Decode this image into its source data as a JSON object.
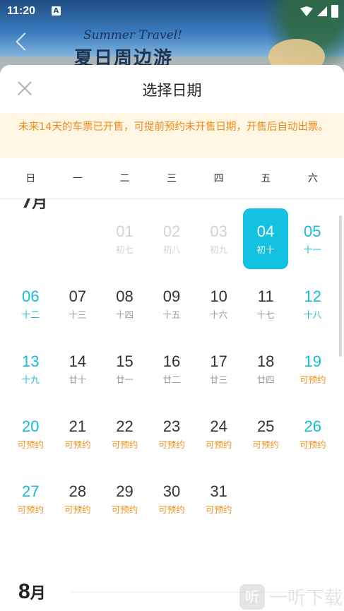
{
  "status_bar": {
    "time": "11:20",
    "notif_icon": "A"
  },
  "banner": {
    "title": "夏日周边游",
    "script": "Summer Travel!"
  },
  "sheet": {
    "title": "选择日期",
    "notice": "未来14天的车票已开售，可提前预约未开售日期，开售后自动出票。",
    "weekdays": [
      "日",
      "一",
      "二",
      "三",
      "四",
      "五",
      "六"
    ],
    "rows": [
      [
        {
          "day": "",
          "sub": "",
          "state": "empty"
        },
        {
          "day": "",
          "sub": "",
          "state": "empty"
        },
        {
          "day": "01",
          "sub": "初七",
          "state": "past"
        },
        {
          "day": "02",
          "sub": "初八",
          "state": "past"
        },
        {
          "day": "03",
          "sub": "初九",
          "state": "past"
        },
        {
          "day": "04",
          "sub": "初十",
          "state": "selected"
        },
        {
          "day": "05",
          "sub": "十一",
          "state": "weekend"
        }
      ],
      [
        {
          "day": "06",
          "sub": "十二",
          "state": "weekend"
        },
        {
          "day": "07",
          "sub": "十三",
          "state": "normal"
        },
        {
          "day": "08",
          "sub": "十四",
          "state": "normal"
        },
        {
          "day": "09",
          "sub": "十五",
          "state": "normal"
        },
        {
          "day": "10",
          "sub": "十六",
          "state": "normal"
        },
        {
          "day": "11",
          "sub": "十七",
          "state": "normal"
        },
        {
          "day": "12",
          "sub": "十八",
          "state": "weekend"
        }
      ],
      [
        {
          "day": "13",
          "sub": "十九",
          "state": "weekend"
        },
        {
          "day": "14",
          "sub": "廿十",
          "state": "normal"
        },
        {
          "day": "15",
          "sub": "廿一",
          "state": "normal"
        },
        {
          "day": "16",
          "sub": "廿二",
          "state": "normal"
        },
        {
          "day": "17",
          "sub": "廿三",
          "state": "normal"
        },
        {
          "day": "18",
          "sub": "廿四",
          "state": "normal"
        },
        {
          "day": "19",
          "sub": "可预约",
          "state": "weekend presale"
        }
      ],
      [
        {
          "day": "20",
          "sub": "可预约",
          "state": "weekend presale"
        },
        {
          "day": "21",
          "sub": "可预约",
          "state": "presale"
        },
        {
          "day": "22",
          "sub": "可预约",
          "state": "presale"
        },
        {
          "day": "23",
          "sub": "可预约",
          "state": "presale"
        },
        {
          "day": "24",
          "sub": "可预约",
          "state": "presale"
        },
        {
          "day": "25",
          "sub": "可预约",
          "state": "presale"
        },
        {
          "day": "26",
          "sub": "可预约",
          "state": "weekend presale"
        }
      ],
      [
        {
          "day": "27",
          "sub": "可预约",
          "state": "weekend presale"
        },
        {
          "day": "28",
          "sub": "可预约",
          "state": "presale"
        },
        {
          "day": "29",
          "sub": "可预约",
          "state": "presale"
        },
        {
          "day": "30",
          "sub": "可预约",
          "state": "presale"
        },
        {
          "day": "31",
          "sub": "可预约",
          "state": "presale"
        },
        {
          "day": "",
          "sub": "",
          "state": "empty"
        },
        {
          "day": "",
          "sub": "",
          "state": "empty"
        }
      ]
    ],
    "next_month": {
      "number": "8",
      "suffix": "月"
    }
  },
  "watermark": {
    "logo": "听",
    "text": "一听下载"
  },
  "colors": {
    "accent": "#13c1e0",
    "presale": "#f0921f",
    "notice_bg": "#fff6e3"
  }
}
